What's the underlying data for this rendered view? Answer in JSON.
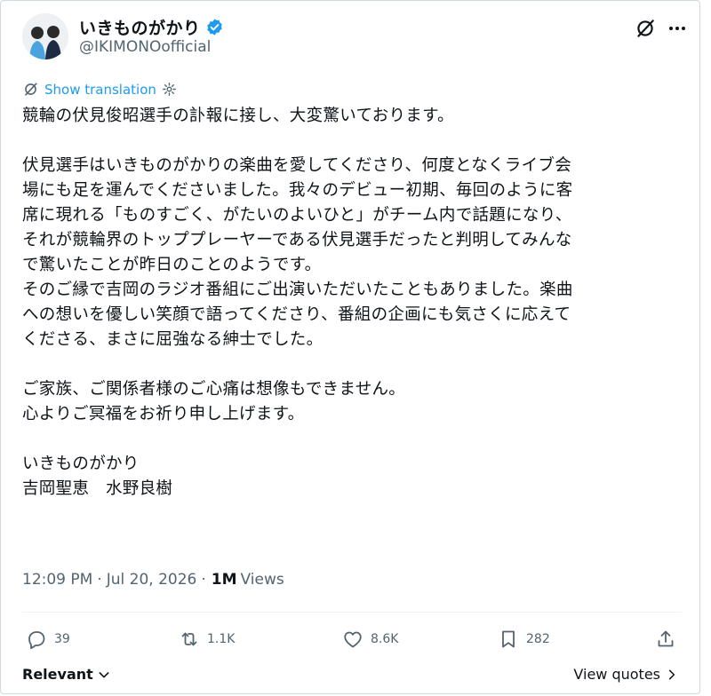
{
  "author": {
    "display_name": "いきものがかり",
    "handle": "@IKIMONOofficial"
  },
  "translate": {
    "label": "Show translation"
  },
  "post": {
    "lines": [
      "競輪の伏見俊昭選手の訃報に接し、大変驚いております。",
      "",
      "伏見選手はいきものがかりの楽曲を愛してくださり、何度となくライブ会",
      "場にも足を運んでくださいました。我々のデビュー初期、毎回のように客",
      "席に現れる「ものすごく、がたいのよいひと」がチーム内で話題になり、",
      "それが競輪界のトッププレーヤーである伏見選手だったと判明してみんな",
      "で驚いたことが昨日のことのようです。",
      "そのご縁で吉岡のラジオ番組にご出演いただいたこともありました。楽曲",
      "への想いを優しい笑顔で語ってくださり、番組の企画にも気さくに応えて",
      "くださる、まさに屈強なる紳士でした。",
      "",
      "ご家族、ご関係者様のご心痛は想像もできません。",
      "心よりご冥福をお祈り申し上げます。",
      "",
      "いきものがかり",
      "吉岡聖恵　水野良樹"
    ]
  },
  "meta": {
    "time": "12:09 PM",
    "separator1": "·",
    "date": "Jul 20, 2026",
    "separator2": "·",
    "views_count": "1M",
    "views_label": "Views"
  },
  "actions": {
    "reply_count": "39",
    "repost_count": "1.1K",
    "like_count": "8.6K",
    "bookmark_count": "282"
  },
  "footer": {
    "sort_label": "Relevant",
    "view_quotes_label": "View quotes"
  },
  "colors": {
    "link": "#1d9bf0",
    "secondary_text": "#536471",
    "primary_text": "#0f1419",
    "border": "#cfd9de"
  },
  "icons": [
    "verified-badge-icon",
    "grok-icon",
    "more-icon",
    "translate-icon",
    "settings-icon",
    "reply-icon",
    "repost-icon",
    "like-icon",
    "bookmark-icon",
    "share-icon",
    "chevron-down-icon",
    "chevron-right-icon"
  ]
}
